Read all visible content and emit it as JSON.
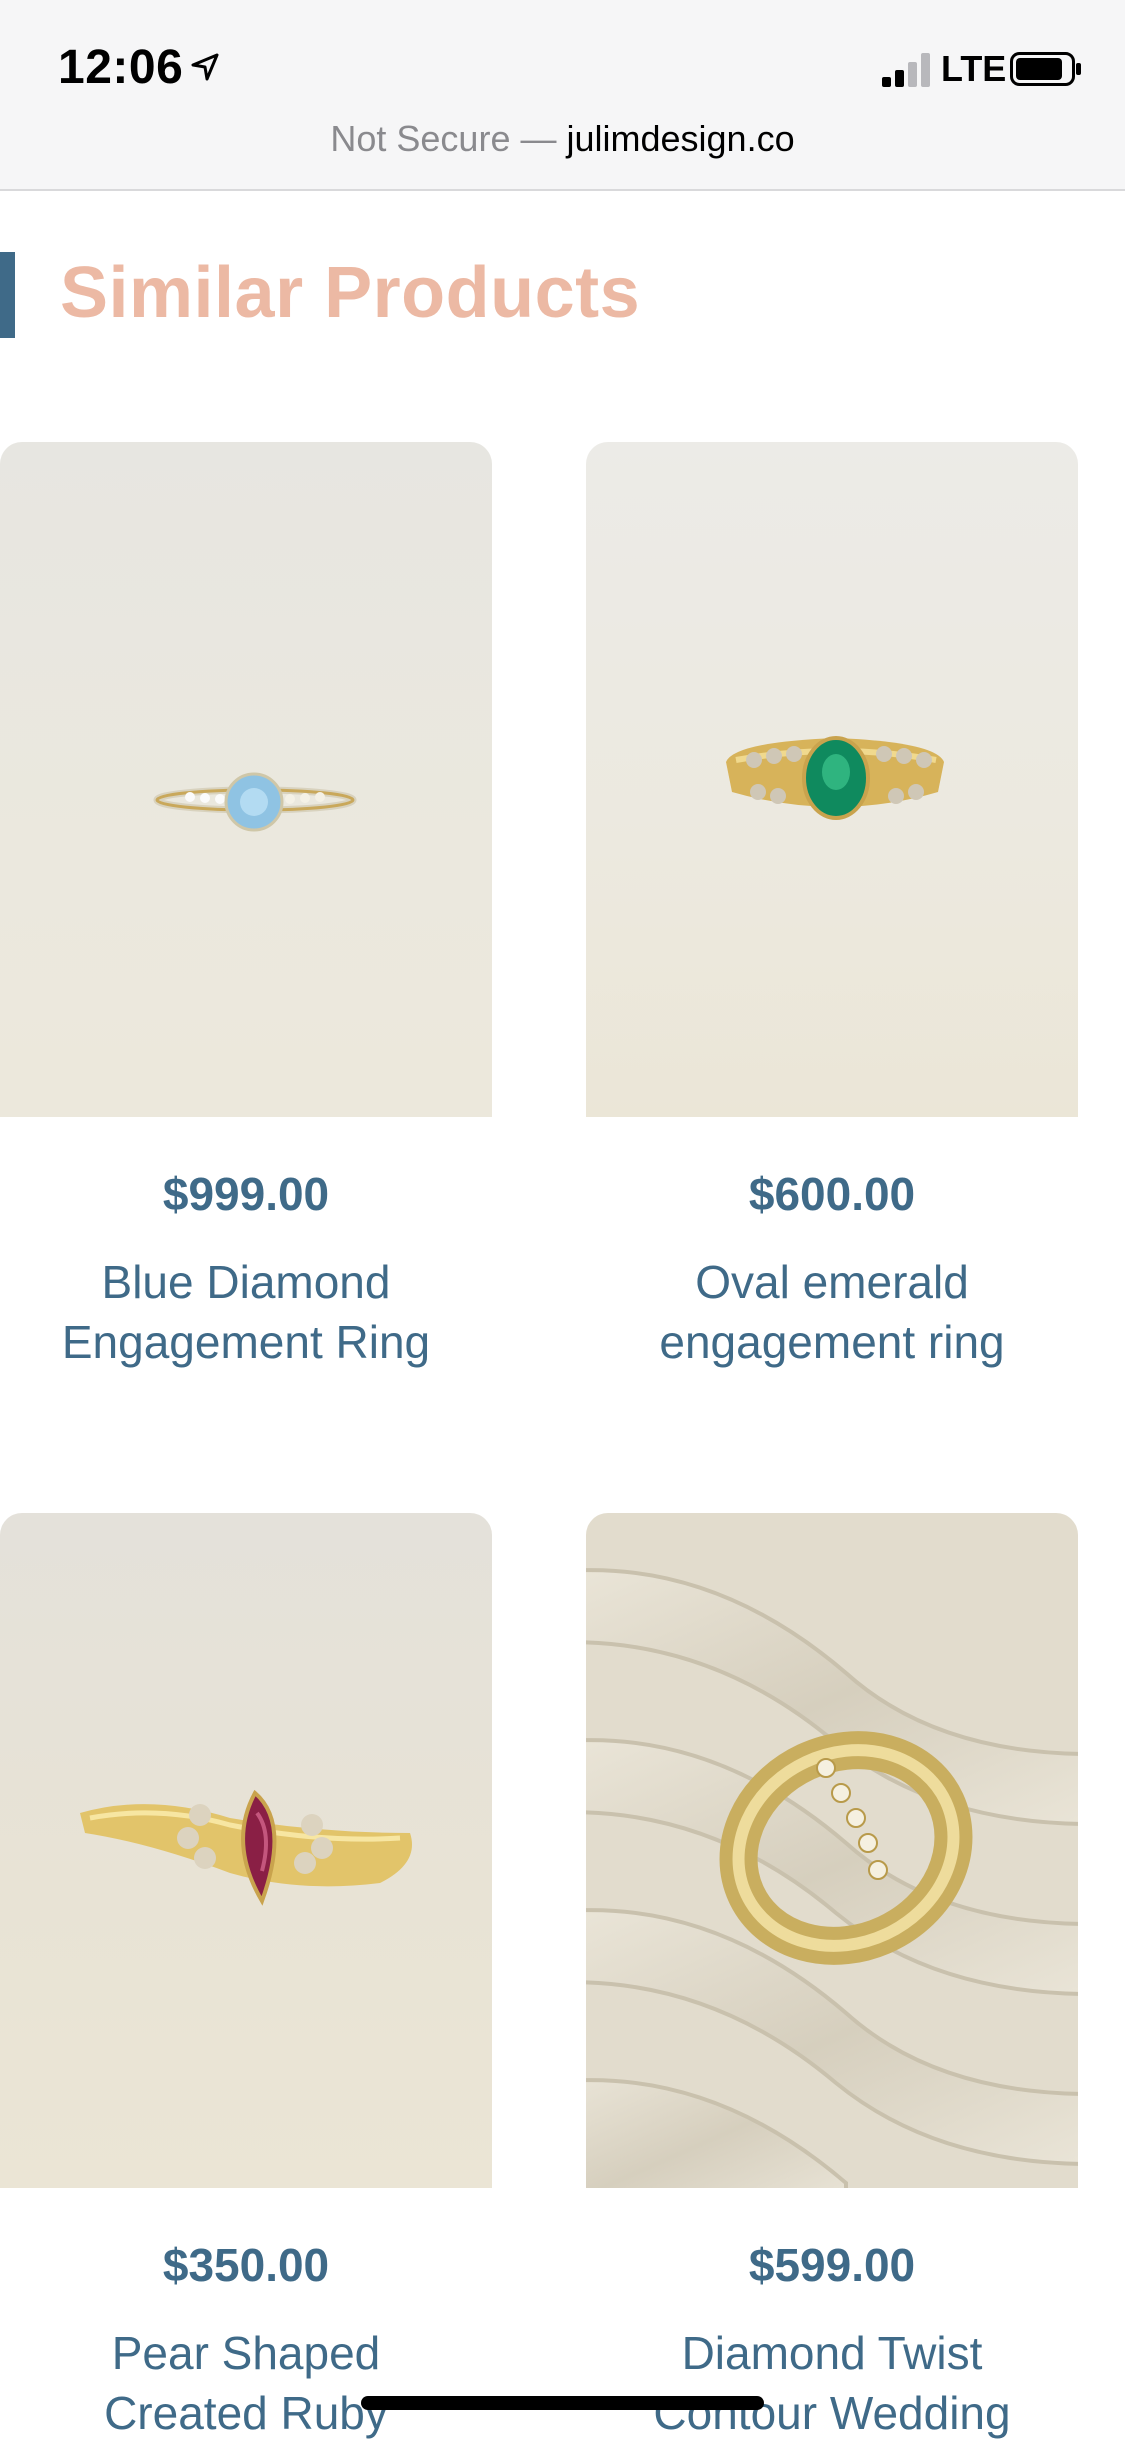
{
  "status_bar": {
    "time": "12:06",
    "carrier": "LTE"
  },
  "browser": {
    "security_label": "Not Secure —",
    "domain": "julimdesign.co"
  },
  "section": {
    "title": "Similar Products"
  },
  "products": [
    {
      "price": "$999.00",
      "name_line1": "Blue Diamond",
      "name_line2": "Engagement Ring",
      "stone_color": "#8fc3e3"
    },
    {
      "price": "$600.00",
      "name_line1": "Oval emerald",
      "name_line2": "engagement ring",
      "stone_color": "#0f8a5e"
    },
    {
      "price": "$350.00",
      "name_line1": "Pear Shaped",
      "name_line2": "Created Ruby",
      "stone_color": "#8a1f45"
    },
    {
      "price": "$599.00",
      "name_line1": "Diamond Twist",
      "name_line2": "Contour Wedding",
      "stone_color": "#f3e7c5"
    }
  ],
  "colors": {
    "heading": "#ecb9a4",
    "accent": "#3f6a88",
    "text": "#3f6a88"
  }
}
